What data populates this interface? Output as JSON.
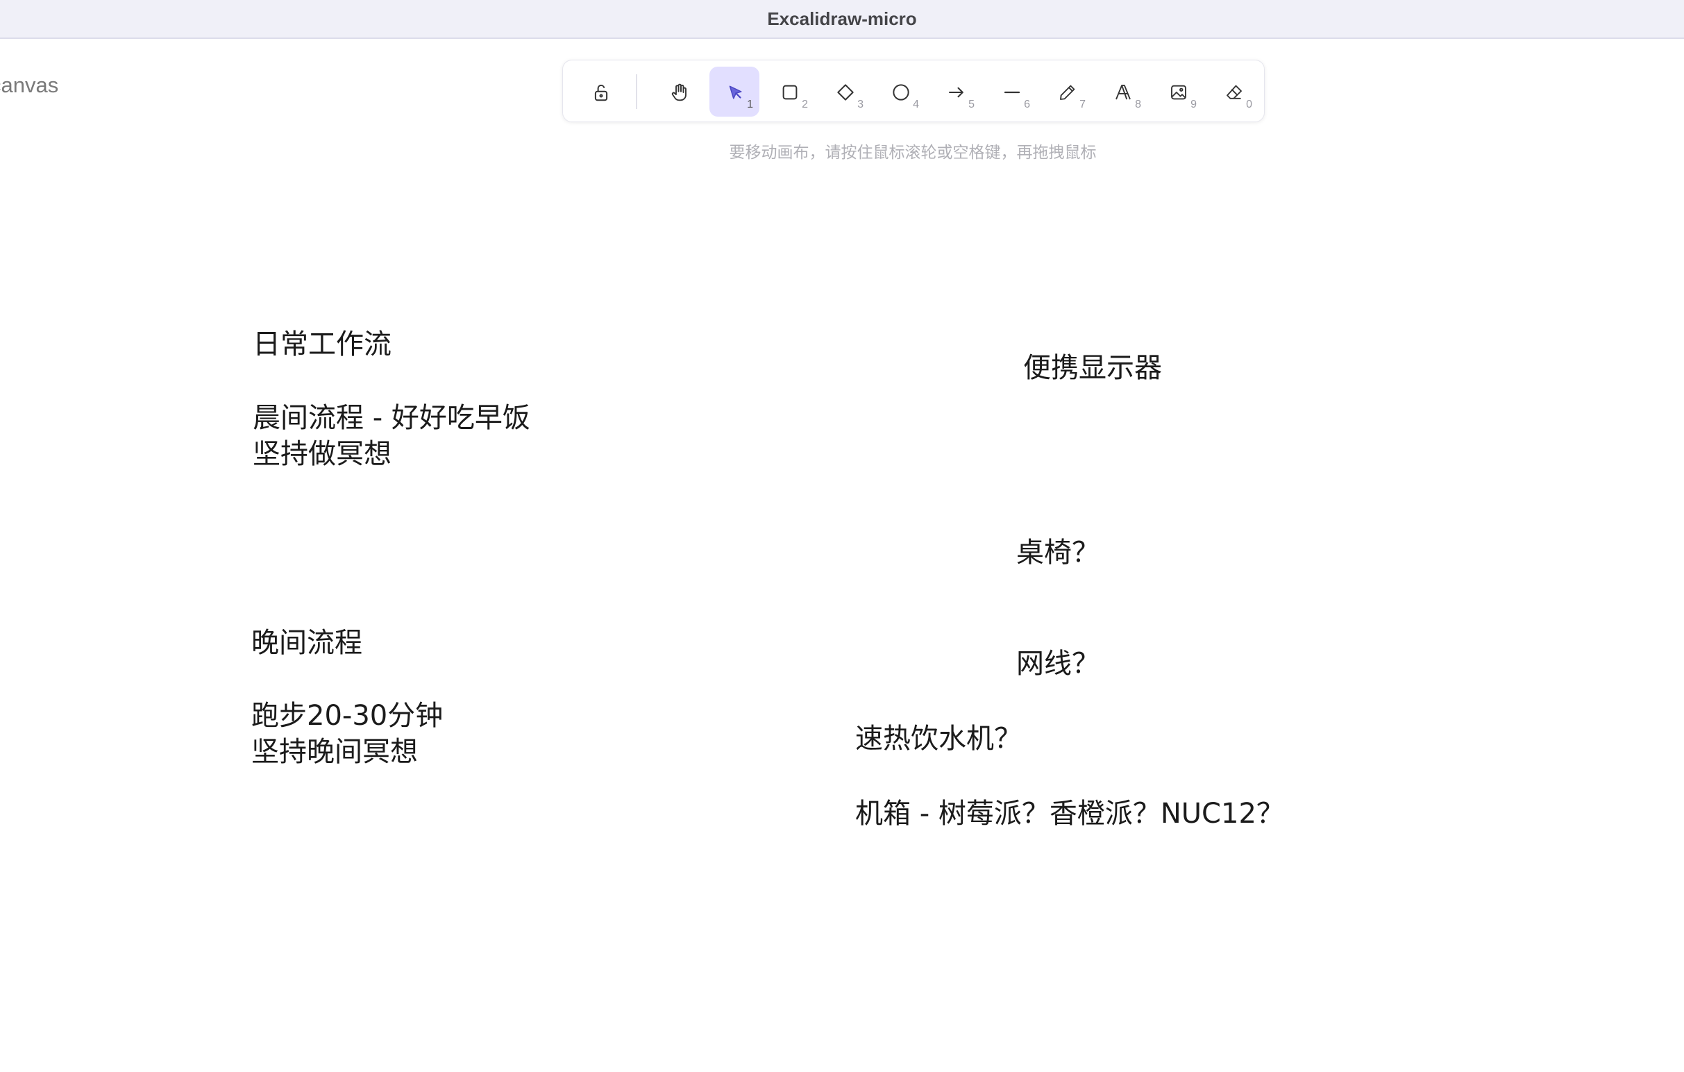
{
  "window": {
    "title": "Excalidraw-micro"
  },
  "sidebar": {
    "clipped_label": "canvas"
  },
  "toolbar": {
    "lock": {
      "icon": "lock-open-icon",
      "label": "Lock"
    },
    "tools": [
      {
        "id": "hand",
        "icon": "hand-icon",
        "key": ""
      },
      {
        "id": "selection",
        "icon": "pointer-icon",
        "key": "1",
        "active": true
      },
      {
        "id": "rectangle",
        "icon": "square-icon",
        "key": "2"
      },
      {
        "id": "diamond",
        "icon": "diamond-icon",
        "key": "3"
      },
      {
        "id": "ellipse",
        "icon": "circle-icon",
        "key": "4"
      },
      {
        "id": "arrow",
        "icon": "arrow-right-icon",
        "key": "5"
      },
      {
        "id": "line",
        "icon": "line-icon",
        "key": "6"
      },
      {
        "id": "draw",
        "icon": "pencil-icon",
        "key": "7"
      },
      {
        "id": "text",
        "icon": "text-icon",
        "key": "8"
      },
      {
        "id": "image",
        "icon": "image-icon",
        "key": "9"
      },
      {
        "id": "eraser",
        "icon": "eraser-icon",
        "key": "0"
      }
    ],
    "active_color": "#e2dfff",
    "accent_color": "#6965db"
  },
  "hint": "要移动画布，请按住鼠标滚轮或空格键，再拖拽鼠标",
  "canvas": {
    "left_notes": {
      "daily_title": "日常工作流",
      "morning": "晨间流程 - 好好吃早饭\n坚持做冥想",
      "evening_title": "晚间流程",
      "evening": "跑步20-30分钟\n坚持晚间冥想"
    },
    "right_notes": {
      "monitor": "便携显示器",
      "desk_chair": "桌椅？",
      "cable": "网线？",
      "water": "速热饮水机？",
      "case": "机箱 - 树莓派？香橙派？NUC12？"
    }
  }
}
